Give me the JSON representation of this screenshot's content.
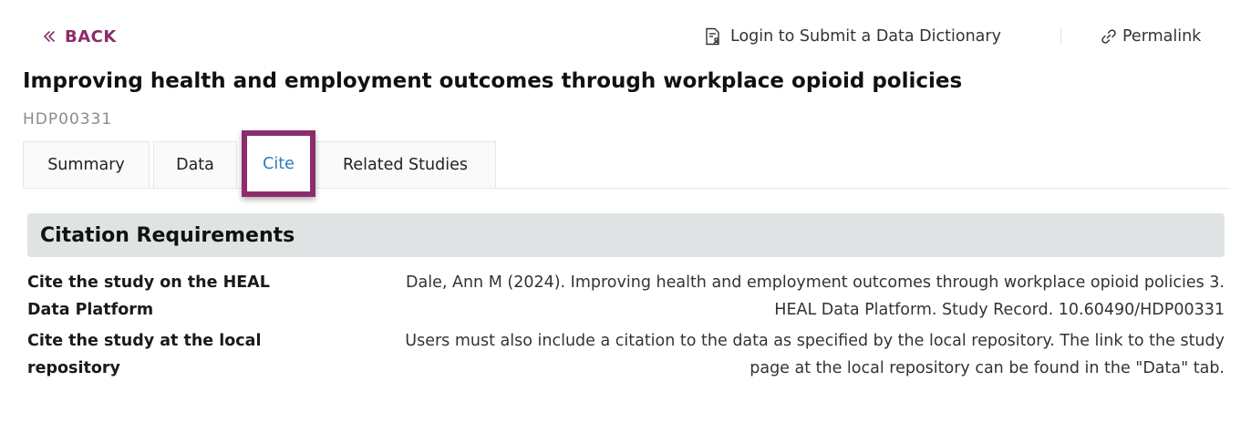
{
  "nav": {
    "back_label": "BACK",
    "login_label": "Login to Submit a Data Dictionary",
    "permalink_label": "Permalink"
  },
  "study": {
    "title": "Improving health and employment outcomes through workplace opioid policies",
    "id": "HDP00331"
  },
  "tabs": [
    {
      "label": "Summary",
      "active": false
    },
    {
      "label": "Data",
      "active": false
    },
    {
      "label": "Cite",
      "active": true
    },
    {
      "label": "Related Studies",
      "active": false
    }
  ],
  "citation": {
    "heading": "Citation Requirements",
    "rows": [
      {
        "label": "Cite the study on the HEAL Data Platform",
        "value": "Dale, Ann M (2024). Improving health and employment outcomes through workplace opioid policies 3. HEAL Data Platform. Study Record. 10.60490/HDP00331"
      },
      {
        "label": "Cite the study at the local repository",
        "value": "Users must also include a citation to the data as specified by the local repository. The link to the study page at the local repository can be found in the \"Data\" tab."
      }
    ]
  },
  "colors": {
    "brand": "#8b2d6b",
    "active_tab_text": "#2a7fb8",
    "section_bg": "#e0e3e3",
    "id_text": "#8c8c8c"
  },
  "icons": {
    "back": "double-chevron-left-icon",
    "login": "document-user-icon",
    "permalink": "link-icon"
  }
}
